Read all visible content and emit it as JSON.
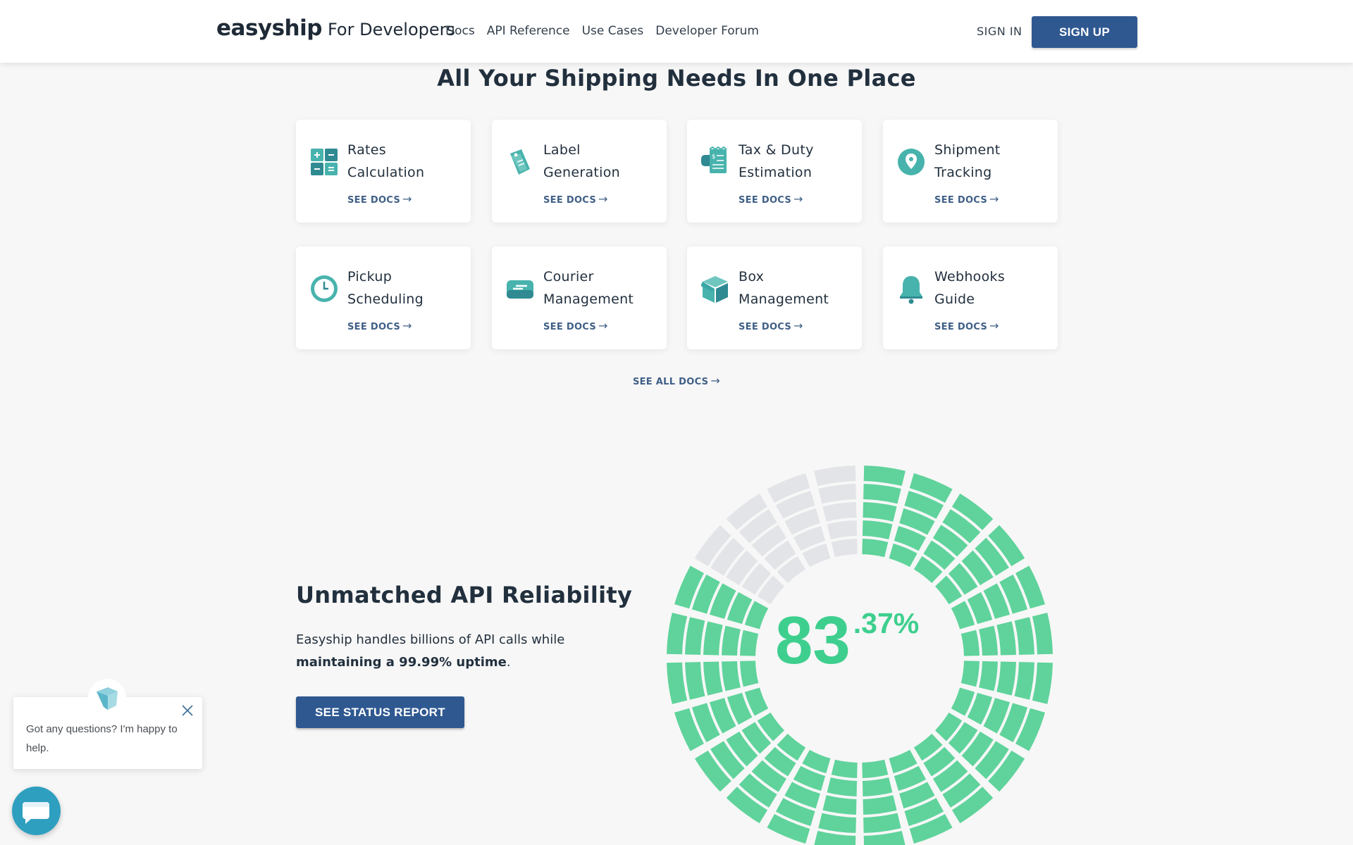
{
  "header": {
    "brand": "easyship",
    "brand_sub": "For Developers",
    "nav": [
      "Docs",
      "API Reference",
      "Use Cases",
      "Developer Forum"
    ],
    "sign_in": "SIGN IN",
    "sign_up": "SIGN UP"
  },
  "features": {
    "title": "All Your Shipping Needs In One Place",
    "cards": [
      {
        "line1": "Rates",
        "line2": "Calculation",
        "link": "SEE DOCS",
        "icon": "calculator-icon"
      },
      {
        "line1": "Label",
        "line2": "Generation",
        "link": "SEE DOCS",
        "icon": "label-tag-icon"
      },
      {
        "line1": "Tax & Duty",
        "line2": "Estimation",
        "link": "SEE DOCS",
        "icon": "tax-receipt-icon"
      },
      {
        "line1": "Shipment",
        "line2": "Tracking",
        "link": "SEE DOCS",
        "icon": "location-pin-icon"
      },
      {
        "line1": "Pickup",
        "line2": "Scheduling",
        "link": "SEE DOCS",
        "icon": "clock-icon"
      },
      {
        "line1": "Courier",
        "line2": "Management",
        "link": "SEE DOCS",
        "icon": "courier-truck-icon"
      },
      {
        "line1": "Box",
        "line2": "Management",
        "link": "SEE DOCS",
        "icon": "box-icon"
      },
      {
        "line1": "Webhooks",
        "line2": "Guide",
        "link": "SEE DOCS",
        "icon": "bell-icon"
      }
    ],
    "see_all": "SEE ALL DOCS"
  },
  "reliability": {
    "title": "Unmatched API Reliability",
    "text_plain": "Easyship handles billions of API calls while",
    "text_bold": "maintaining a 99.99% uptime",
    "text_end": ".",
    "button": "SEE STATUS REPORT",
    "percent_main": "83",
    "percent_decimal": ".37%",
    "percent_value": 83.37,
    "colors": {
      "filled": "#5fd39b",
      "empty": "#e3e4e8",
      "accent": "#3ecf8e"
    }
  },
  "chat": {
    "message": "Got any questions? I'm happy to help."
  },
  "colors": {
    "primary_button": "#2f5891",
    "link": "#3f5f86",
    "icon_teal": "#3aa6a6"
  }
}
